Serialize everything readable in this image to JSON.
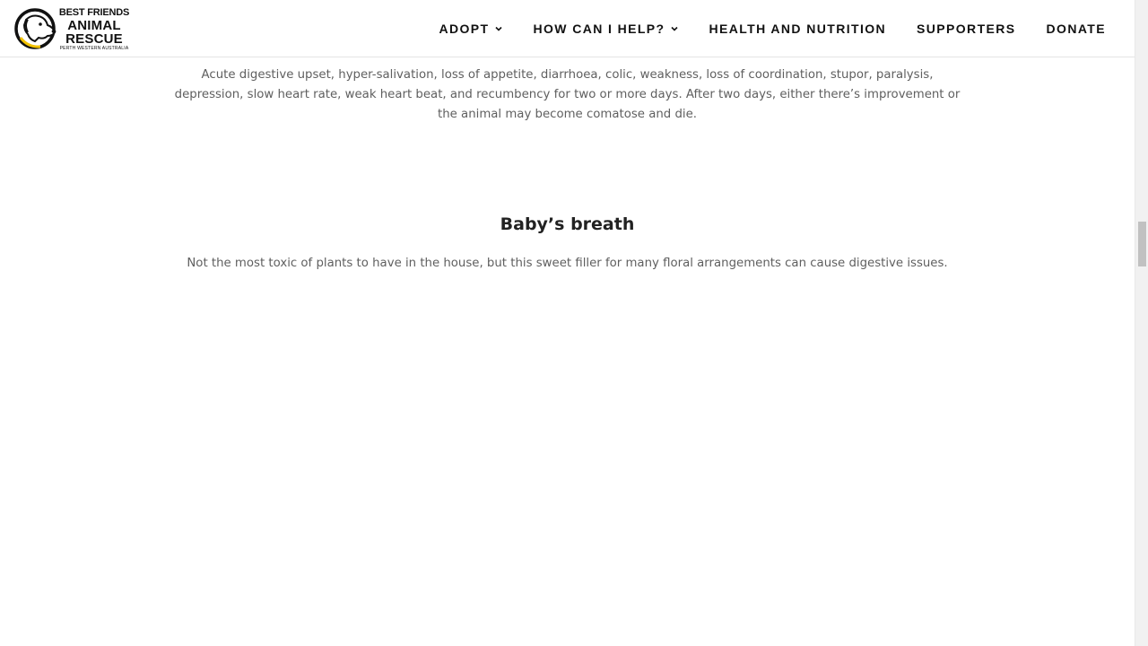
{
  "header": {
    "logo": {
      "line1": "BEST FRIENDS",
      "line2": "ANIMAL",
      "line3": "RESCUE",
      "line4": "PERTH WESTERN AUSTRALIA"
    },
    "nav": [
      {
        "label": "ADOPT",
        "has_dropdown": true
      },
      {
        "label": "HOW CAN I HELP?",
        "has_dropdown": true
      },
      {
        "label": "HEALTH AND NUTRITION",
        "has_dropdown": false
      },
      {
        "label": "SUPPORTERS",
        "has_dropdown": false
      },
      {
        "label": "DONATE",
        "has_dropdown": false
      }
    ]
  },
  "main": {
    "symptoms_text": "Acute digestive upset, hyper-salivation, loss of appetite, diarrhoea, colic, weakness, loss of coordination, stupor, paralysis, depression, slow heart rate, weak heart beat, and recumbency for two or more days. After two days, either there’s improvement or the animal may become comatose and die.",
    "section_heading": "Baby’s breath",
    "section_text": "Not the most toxic of plants to have in the house, but this sweet filler for many floral arrangements can cause digestive issues."
  },
  "colors": {
    "text_dark": "#222222",
    "text_body": "#5f5f5f",
    "logo_accent": "#f2c200"
  }
}
